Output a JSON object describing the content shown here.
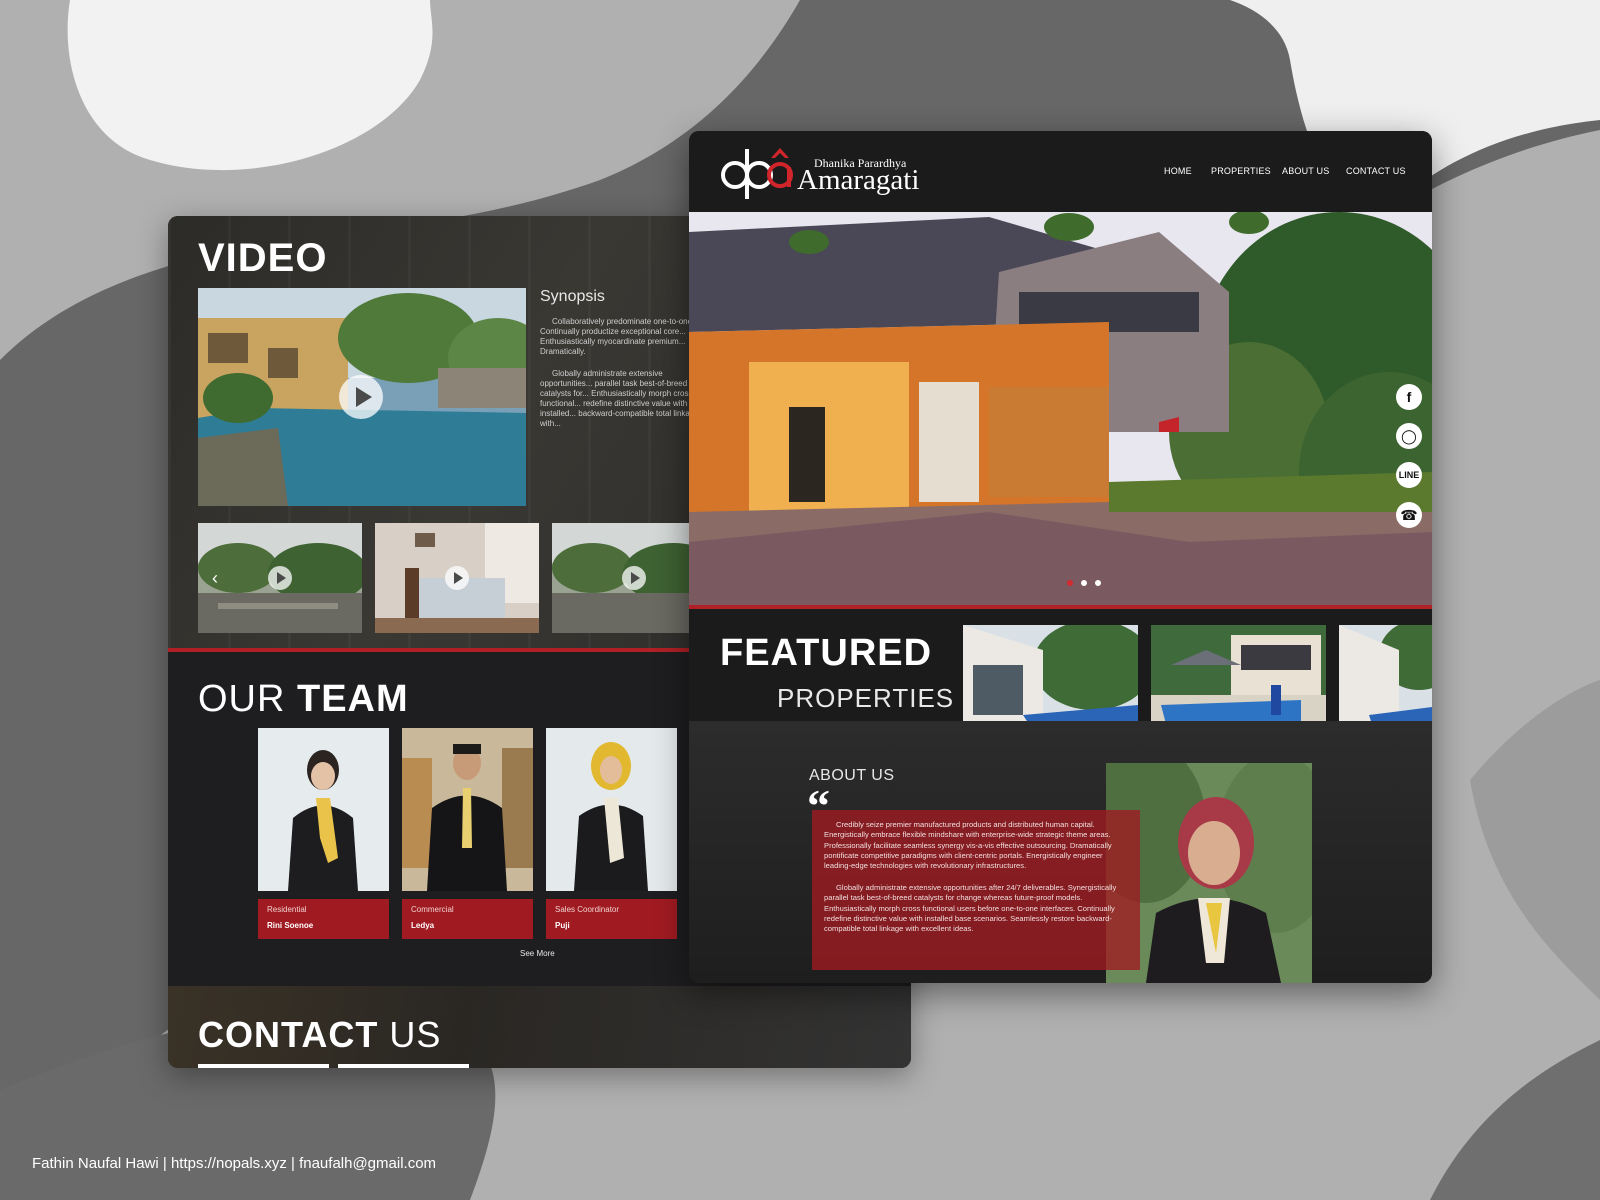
{
  "left_page": {
    "video": {
      "title": "VIDEO",
      "synopsis_title": "Synopsis",
      "synopsis_p1": "Collaboratively predominate one-to-one... Continually productize exceptional core... Enthusiastically myocardinate premium... Dramatically.",
      "synopsis_p2": "Globally administrate extensive opportunities... parallel task best-of-breed catalysts for... Enthusiastically morph cross functional... redefine distinctive value with installed... backward-compatible total linkage with..."
    },
    "team": {
      "title_light": "OUR ",
      "title_bold": "TEAM",
      "members": [
        {
          "role": "Residential",
          "name": "Rini Soenoe"
        },
        {
          "role": "Commercial",
          "name": "Ledya"
        },
        {
          "role": "Sales Coordinator",
          "name": "Puji"
        }
      ],
      "see_more": "See More"
    },
    "contact": {
      "title_bold": "CONTACT",
      "title_light": " US"
    }
  },
  "right_page": {
    "logo": {
      "subtitle": "Dhanika Parardhya",
      "name": "Amaragati"
    },
    "nav": [
      "HOME",
      "PROPERTIES",
      "ABOUT US",
      "CONTACT US"
    ],
    "social_icons": [
      "facebook-icon",
      "instagram-icon",
      "line-icon",
      "whatsapp-icon"
    ],
    "slider_dots": 3,
    "active_dot": 0,
    "featured": {
      "title": "FEATURED",
      "subtitle": "PROPERTIES"
    },
    "about": {
      "title": "ABOUT US",
      "p1": "Credibly seize premier manufactured products and distributed human capital. Energistically embrace flexible mindshare with enterprise-wide strategic theme areas. Professionally facilitate seamless synergy vis-a-vis effective outsourcing. Dramatically pontificate competitive paradigms with client-centric portals. Energistically engineer leading-edge technologies with revolutionary infrastructures.",
      "p2": "Globally administrate extensive opportunities after 24/7 deliverables. Synergistically parallel task best-of-breed catalysts for change whereas future-proof models. Enthusiastically morph cross functional users before one-to-one interfaces. Continually redefine distinctive value with installed base scenarios. Seamlessly restore backward-compatible total linkage with excellent ideas."
    }
  },
  "footer": "Fathin Naufal Hawi | https://nopals.xyz | fnaufalh@gmail.com",
  "colors": {
    "accent_red": "#b02025",
    "panel_dark": "#1b1b1c",
    "background_gray": "#b1b1b1"
  }
}
